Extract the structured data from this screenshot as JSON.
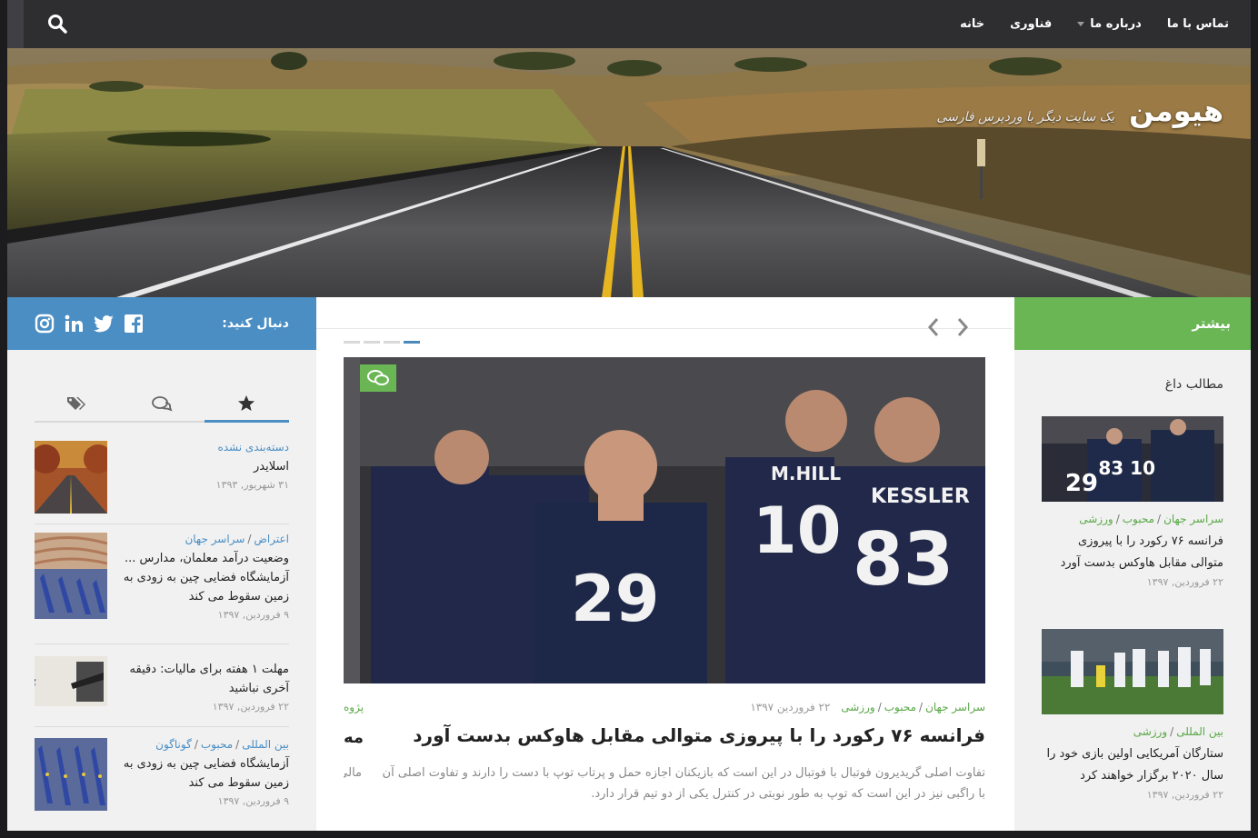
{
  "nav": {
    "items": [
      {
        "label": "خانه"
      },
      {
        "label": "فناوری"
      },
      {
        "label": "درباره ما"
      },
      {
        "label": "تماس با ما"
      }
    ]
  },
  "header": {
    "site_name": "هیومن",
    "tagline": "یک سایت دیگر با وردپرس فارسی"
  },
  "right_sidebar": {
    "title": "بیشتر",
    "section_title": "مطالب داغ",
    "posts": [
      {
        "cats": [
          "سراسر جهان",
          "محبوب",
          "ورزشی"
        ],
        "title": "فرانسه ۷۶ رکورد را با پیروزی متوالی مقابل هاوکس بدست آورد",
        "date": "۲۲ فروردین, ۱۳۹۷"
      },
      {
        "cats": [
          "بین المللی",
          "ورزشی"
        ],
        "title": "ستارگان آمریکایی اولین بازی خود را سال ۲۰۲۰ برگزار خواهند کرد",
        "date": "۲۲ فروردین, ۱۳۹۷"
      }
    ]
  },
  "featured": {
    "cats": [
      "سراسر جهان",
      "محبوب",
      "ورزشی"
    ],
    "date": "۲۲ فروردین ۱۳۹۷",
    "title": "فرانسه ۷۶ رکورد را با پیروزی متوالی مقابل هاوکس بدست آورد",
    "excerpt": "تفاوت اصلی گریدیرون فوتبال با فوتبال در این است که بازیکنان اجازه حمل و پرتاب توپ با دست را دارند و تفاوت اصلی آن با راگبی نیز در این است که توپ به طور نوبتی در کنترل یکی از دو تیم قرار دارد.",
    "peek_cat": "پژوه",
    "peek_title": "مه",
    "peek_excerpt": "مالی شخ"
  },
  "left_sidebar": {
    "follow_label": "دنبال کنید:",
    "posts": [
      {
        "cats": [
          "دسته‌بندی نشده"
        ],
        "title": "اسلایدر",
        "date": "۳۱ شهریور, ۱۳۹۳"
      },
      {
        "cats": [
          "اعتراض",
          "سراسر جهان"
        ],
        "title": "وضعیت درآمد معلمان، مدارس ... آزمایشگاه فضایی چین به زودی به زمین سقوط می کند",
        "date": "۹ فروردین, ۱۳۹۷"
      },
      {
        "cats": [],
        "title": "مهلت ۱ هفته برای مالیات: دقیقه آخری نباشید",
        "date": "۲۲ فروردین, ۱۳۹۷"
      },
      {
        "cats": [
          "بین المللی",
          "محبوب",
          "گوناگون"
        ],
        "title": "آزمایشگاه فضایی چین به زودی به زمین سقوط می کند",
        "date": "۹ فروردین, ۱۳۹۷"
      }
    ]
  },
  "colors": {
    "green": "#6ab655",
    "blue": "#4a8ec4",
    "nav": "#2e2e31"
  }
}
